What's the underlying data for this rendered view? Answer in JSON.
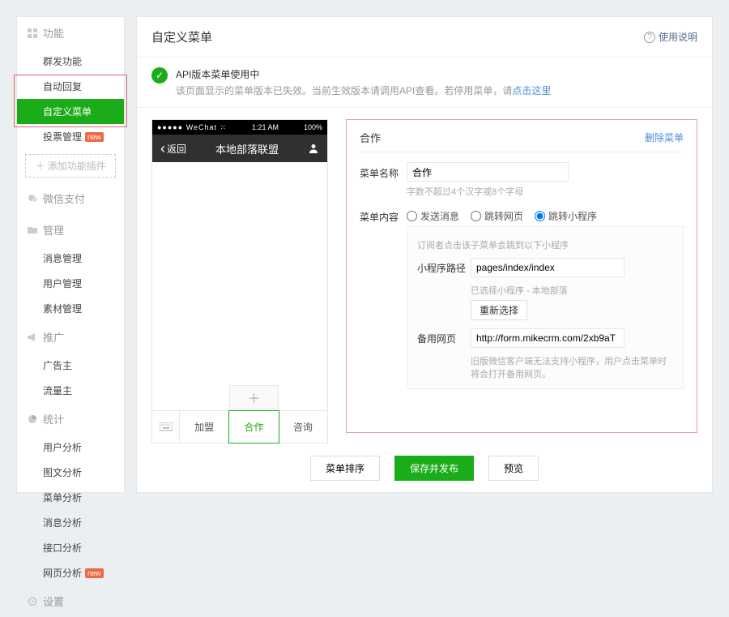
{
  "sidebar": {
    "groups": [
      {
        "title": "功能",
        "icon": "grid",
        "items": [
          {
            "label": "群发功能"
          },
          {
            "label": "自动回复"
          },
          {
            "label": "自定义菜单",
            "active": true,
            "outlined": true
          },
          {
            "label": "投票管理",
            "badge": "new"
          }
        ],
        "add_plugin": "添加功能插件"
      },
      {
        "title": "微信支付",
        "icon": "wechat",
        "items": []
      },
      {
        "title": "管理",
        "icon": "folder",
        "items": [
          {
            "label": "消息管理"
          },
          {
            "label": "用户管理"
          },
          {
            "label": "素材管理"
          }
        ]
      },
      {
        "title": "推广",
        "icon": "megaphone",
        "items": [
          {
            "label": "广告主"
          },
          {
            "label": "流量主"
          }
        ]
      },
      {
        "title": "统计",
        "icon": "pie",
        "items": [
          {
            "label": "用户分析"
          },
          {
            "label": "图文分析"
          },
          {
            "label": "菜单分析"
          },
          {
            "label": "消息分析"
          },
          {
            "label": "接口分析"
          },
          {
            "label": "网页分析",
            "badge": "new"
          }
        ]
      },
      {
        "title": "设置",
        "icon": "gear",
        "items": []
      }
    ]
  },
  "header": {
    "title": "自定义菜单",
    "help": "使用说明"
  },
  "notice": {
    "title": "API版本菜单使用中",
    "sub_prefix": "该页面显示的菜单版本已失效。当前生效版本请调用API查看。若停用菜单，请",
    "link": "点击这里"
  },
  "phone": {
    "carrier": "WeChat",
    "time": "1:21 AM",
    "battery": "100%",
    "back": "返回",
    "title": "本地部落联盟",
    "tabs": [
      "加盟",
      "合作",
      "咨询"
    ],
    "active_tab": 1
  },
  "panel": {
    "name": "合作",
    "delete": "删除菜单",
    "name_label": "菜单名称",
    "name_value": "合作",
    "name_hint": "字数不超过4个汉字或8个字母",
    "content_label": "菜单内容",
    "radios": {
      "msg": "发送消息",
      "web": "跳转网页",
      "mini": "跳转小程序"
    },
    "selected_radio": "mini",
    "mini_intro": "订阅者点击该子菜单会跳到以下小程序",
    "mini_path_label": "小程序路径",
    "mini_path_value": "pages/index/index",
    "mini_selected_prefix": "已选择小程序 - 本地部落",
    "mini_reselect": "重新选择",
    "fallback_label": "备用网页",
    "fallback_value": "http://form.mikecrm.com/2xb9aT",
    "fallback_hint": "旧版微信客户端无法支持小程序，用户点击菜单时将会打开备用网页。"
  },
  "footer": {
    "sort": "菜单排序",
    "save": "保存并发布",
    "preview": "预览"
  }
}
